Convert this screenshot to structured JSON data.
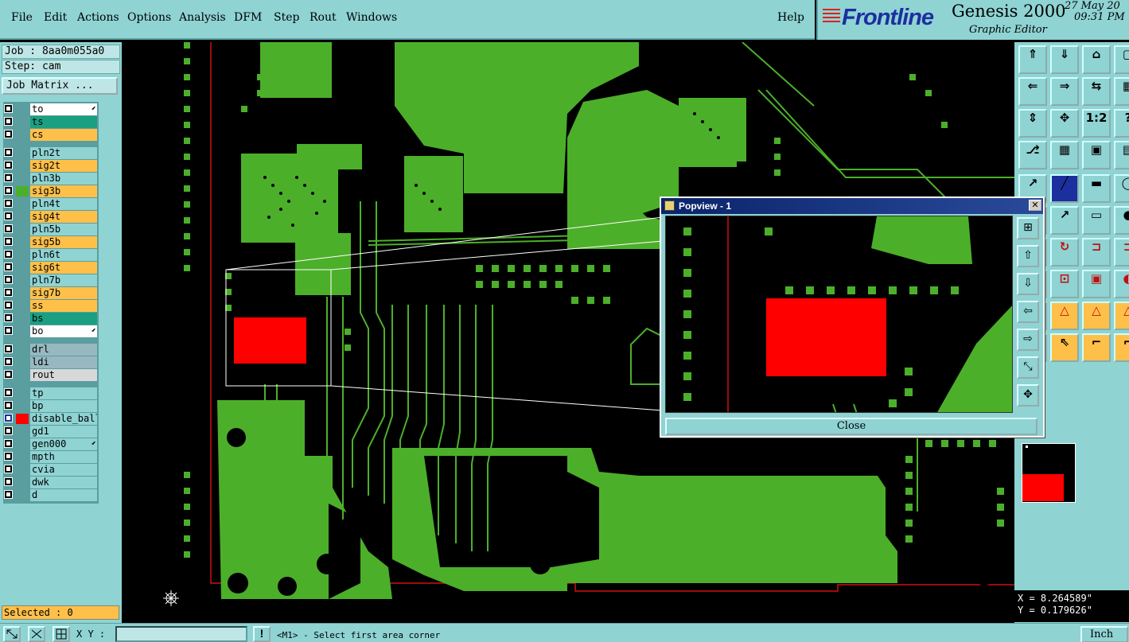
{
  "menus": [
    "File",
    "Edit",
    "Actions",
    "Options",
    "Analysis",
    "DFM",
    "Step",
    "Rout",
    "Windows"
  ],
  "help": "Help",
  "brand": {
    "logo": "Frontline",
    "title": "Genesis 2000",
    "subtitle": "Graphic Editor",
    "date": "27 May 20",
    "time": "09:31 PM"
  },
  "job": {
    "job_line": "Job : 8aa0m055a0",
    "step_line": "Step: cam",
    "job_matrix": "Job Matrix ..."
  },
  "layers": [
    {
      "name": "to",
      "color": "#ffffff",
      "mark": true
    },
    {
      "name": "ts",
      "color": "#1aa080"
    },
    {
      "name": "cs",
      "color": "#ffc04a"
    },
    {
      "name": "pln2t",
      "color": "#8fd3d3"
    },
    {
      "name": "sig2t",
      "color": "#ffc04a"
    },
    {
      "name": "pln3b",
      "color": "#8fd3d3"
    },
    {
      "name": "sig3b",
      "color": "#ffc04a",
      "active": "#4caf2a"
    },
    {
      "name": "pln4t",
      "color": "#8fd3d3"
    },
    {
      "name": "sig4t",
      "color": "#ffc04a"
    },
    {
      "name": "pln5b",
      "color": "#8fd3d3"
    },
    {
      "name": "sig5b",
      "color": "#ffc04a"
    },
    {
      "name": "pln6t",
      "color": "#8fd3d3"
    },
    {
      "name": "sig6t",
      "color": "#ffc04a"
    },
    {
      "name": "pln7b",
      "color": "#8fd3d3"
    },
    {
      "name": "sig7b",
      "color": "#ffc04a"
    },
    {
      "name": "ss",
      "color": "#ffc04a"
    },
    {
      "name": "bs",
      "color": "#1aa080"
    },
    {
      "name": "bo",
      "color": "#ffffff",
      "mark": true
    },
    {
      "name": "drl",
      "color": "#98b8c0"
    },
    {
      "name": "ldi",
      "color": "#98b8c0"
    },
    {
      "name": "rout",
      "color": "#d8d8d8"
    },
    {
      "name": "tp",
      "color": "#8fd3d3"
    },
    {
      "name": "bp",
      "color": "#8fd3d3"
    },
    {
      "name": "disable_balls",
      "color": "#8fd3d3",
      "active": "#ff0000",
      "checked": true
    },
    {
      "name": "gd1",
      "color": "#8fd3d3"
    },
    {
      "name": "gen000",
      "color": "#8fd3d3",
      "mark": true
    },
    {
      "name": "mpth",
      "color": "#8fd3d3"
    },
    {
      "name": "cvia",
      "color": "#8fd3d3"
    },
    {
      "name": "dwk",
      "color": "#8fd3d3"
    },
    {
      "name": "d",
      "color": "#8fd3d3"
    }
  ],
  "selected": "Selected : 0",
  "popview": {
    "title": "Popview - 1",
    "close_label": "Close",
    "close_x": "✕"
  },
  "coords": {
    "x": "X = 8.264589\"",
    "y": "Y = 0.179626\""
  },
  "status": {
    "xy_label": "X Y :",
    "xy_value": "",
    "warn": "!",
    "prompt": "<M1> - Select first area corner",
    "units": "Inch"
  },
  "colors": {
    "board": "#4caf2a",
    "selected_feature": "#ff0000",
    "panel": "#8fd3d3",
    "rout_outline": "#d01010"
  }
}
